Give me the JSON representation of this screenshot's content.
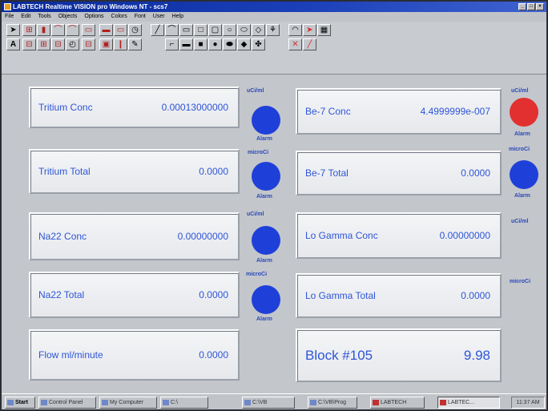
{
  "window": {
    "title": "LABTECH Realtime VISION pro Windows NT - scs7"
  },
  "menu": [
    "File",
    "Edit",
    "Tools",
    "Objects",
    "Options",
    "Colors",
    "Font",
    "User",
    "Help"
  ],
  "panels_left": [
    {
      "label": "Tritium Conc",
      "value": "0.00013000000",
      "unit": "uCi/ml",
      "alarm": "Alarm",
      "alarm_state": "normal"
    },
    {
      "label": "Tritium Total",
      "value": "0.0000",
      "unit": "microCi",
      "alarm": "Alarm",
      "alarm_state": "normal"
    },
    {
      "label": "Na22 Conc",
      "value": "0.00000000",
      "unit": "uCi/ml",
      "alarm": "Alarm",
      "alarm_state": "normal"
    },
    {
      "label": "Na22 Total",
      "value": "0.0000",
      "unit": "microCi",
      "alarm": "Alarm",
      "alarm_state": "normal"
    },
    {
      "label": "Flow ml/minute",
      "value": "0.0000"
    }
  ],
  "panels_right": [
    {
      "label": "Be-7 Conc",
      "value": "4.4999999e-007",
      "unit": "uCi/ml",
      "alarm": "Alarm",
      "alarm_state": "alarm"
    },
    {
      "label": "Be-7 Total",
      "value": "0.0000",
      "unit": "microCi",
      "alarm": "Alarm",
      "alarm_state": "normal"
    },
    {
      "label": "Lo Gamma Conc",
      "value": "0.00000000",
      "unit": "uCi/ml"
    },
    {
      "label": "Lo Gamma Total",
      "value": "0.0000",
      "unit": "microCi"
    },
    {
      "label": "Block #105",
      "value": "9.98"
    }
  ],
  "taskbar": {
    "start": "Start",
    "items": [
      "Control Panel",
      "My Computer",
      "C:\\",
      "C:\\VB",
      "C:\\VB\\Prog",
      "LABTECH",
      "LABTEC..."
    ],
    "clock": "11:37 AM"
  },
  "colors": {
    "alarm_normal": "#1f40d8",
    "alarm_active": "#e23030",
    "text_accent": "#2f56d8"
  }
}
